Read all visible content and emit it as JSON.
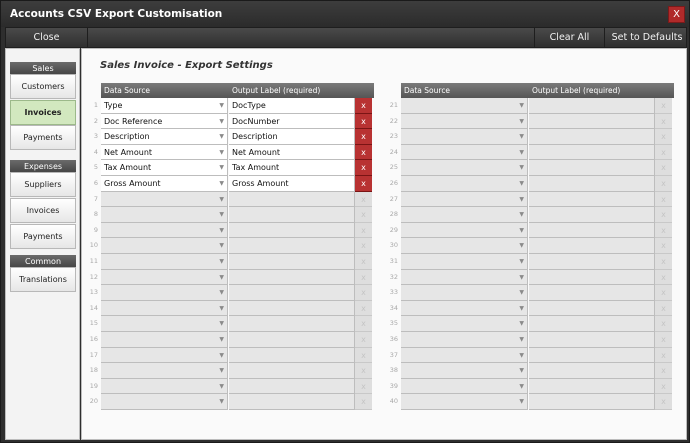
{
  "window": {
    "title": "Accounts CSV Export Customisation",
    "close_glyph": "X"
  },
  "toolbar": {
    "close": "Close",
    "clear_all": "Clear All",
    "set_defaults": "Set to Defaults"
  },
  "sidebar": {
    "groups": [
      {
        "title": "Sales",
        "items": [
          "Customers",
          "Invoices",
          "Payments"
        ]
      },
      {
        "title": "Expenses",
        "items": [
          "Suppliers",
          "Invoices",
          "Payments"
        ]
      },
      {
        "title": "Common",
        "items": [
          "Translations"
        ]
      }
    ],
    "active": "Sales/Invoices"
  },
  "main": {
    "section_title": "Sales Invoice - Export Settings",
    "col_source": "Data Source",
    "col_label": "Output Label (required)",
    "delete_glyph": "x",
    "rows": [
      {
        "source": "Type",
        "label": "DocType"
      },
      {
        "source": "Doc Reference",
        "label": "DocNumber"
      },
      {
        "source": "Description",
        "label": "Description"
      },
      {
        "source": "Net Amount",
        "label": "Net Amount"
      },
      {
        "source": "Tax Amount",
        "label": "Tax Amount"
      },
      {
        "source": "Gross Amount",
        "label": "Gross Amount"
      }
    ],
    "row_count": 40,
    "rows_per_table": 20
  },
  "colors": {
    "delete": "#b83232",
    "active_nav": "#d2e8bf",
    "header": "#5f5f5f"
  },
  "icons": {
    "dropdown": "triangle-down-icon",
    "delete": "delete-x-icon",
    "window_close": "close-icon"
  }
}
